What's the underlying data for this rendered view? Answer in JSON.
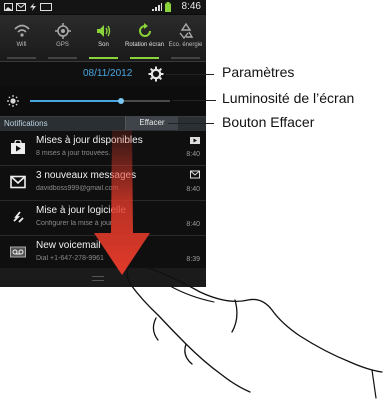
{
  "status_bar": {
    "time": "8:46"
  },
  "quick_settings": [
    {
      "label": "Wifi",
      "icon": "wifi-icon",
      "on": false
    },
    {
      "label": "GPS",
      "icon": "gps-icon",
      "on": false
    },
    {
      "label": "Son",
      "icon": "sound-icon",
      "on": true
    },
    {
      "label": "Rotation écran",
      "icon": "rotation-icon",
      "on": true
    },
    {
      "label": "Eco. énergie",
      "icon": "recycle-icon",
      "on": false
    }
  ],
  "date": "08/11/2012",
  "brightness": {
    "level": 0.65
  },
  "notifications_header": {
    "label": "Notifications",
    "clear_label": "Effacer"
  },
  "notifications": [
    {
      "title": "Mises à jour disponibles",
      "subtitle": "8 mises à jour trouvées.",
      "time": "8:40",
      "icon": "play-store-icon"
    },
    {
      "title": "3 nouveaux messages",
      "subtitle": "davidboss999@gmail.com",
      "time": "8:40",
      "icon": "mail-icon"
    },
    {
      "title": "Mise à jour logicielle",
      "subtitle": "Configurer la mise à jour",
      "time": "8:40",
      "icon": "update-icon"
    },
    {
      "title": "New voicemail",
      "subtitle": "Dial +1-647-278-9961",
      "time": "8:39",
      "icon": "voicemail-icon"
    }
  ],
  "callouts": {
    "settings": "Paramètres",
    "brightness": "Luminosité de l’écran",
    "clear": "Bouton Effacer"
  },
  "colors": {
    "accent_blue": "#4aa6e0",
    "toggle_on": "#8bd33a",
    "arrow_red": "#e23a2a"
  }
}
